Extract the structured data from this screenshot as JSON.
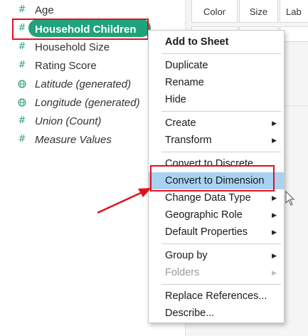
{
  "marks_card": {
    "buttons": [
      {
        "label": "Color"
      },
      {
        "label": "Size"
      },
      {
        "label": "Lab"
      }
    ]
  },
  "fields": [
    {
      "label": "Age",
      "type_icon": "#",
      "italic": false,
      "selected": false
    },
    {
      "label": "Household Children",
      "type_icon": "#",
      "italic": false,
      "selected": true
    },
    {
      "label": "Household Size",
      "type_icon": "#",
      "italic": false,
      "selected": false
    },
    {
      "label": "Rating Score",
      "type_icon": "#",
      "italic": false,
      "selected": false
    },
    {
      "label": "Latitude (generated)",
      "type_icon": "globe-icon",
      "italic": true,
      "selected": false
    },
    {
      "label": "Longitude (generated)",
      "type_icon": "globe-icon",
      "italic": true,
      "selected": false
    },
    {
      "label": "Union (Count)",
      "type_icon": "#",
      "italic": true,
      "selected": false
    },
    {
      "label": "Measure Values",
      "type_icon": "#",
      "italic": true,
      "selected": false
    }
  ],
  "context_menu": {
    "groups": [
      [
        {
          "label": "Add to Sheet",
          "bold": true,
          "submenu": false,
          "disabled": false,
          "highlighted": false
        }
      ],
      [
        {
          "label": "Duplicate",
          "submenu": false,
          "disabled": false,
          "highlighted": false
        },
        {
          "label": "Rename",
          "submenu": false,
          "disabled": false,
          "highlighted": false
        },
        {
          "label": "Hide",
          "submenu": false,
          "disabled": false,
          "highlighted": false
        }
      ],
      [
        {
          "label": "Create",
          "submenu": true,
          "disabled": false,
          "highlighted": false
        },
        {
          "label": "Transform",
          "submenu": true,
          "disabled": false,
          "highlighted": false
        }
      ],
      [
        {
          "label": "Convert to Discrete",
          "submenu": false,
          "disabled": false,
          "highlighted": false
        },
        {
          "label": "Convert to Dimension",
          "submenu": false,
          "disabled": false,
          "highlighted": true
        },
        {
          "label": "Change Data Type",
          "submenu": true,
          "disabled": false,
          "highlighted": false
        },
        {
          "label": "Geographic Role",
          "submenu": true,
          "disabled": false,
          "highlighted": false
        },
        {
          "label": "Default Properties",
          "submenu": true,
          "disabled": false,
          "highlighted": false
        }
      ],
      [
        {
          "label": "Group by",
          "submenu": true,
          "disabled": false,
          "highlighted": false
        },
        {
          "label": "Folders",
          "submenu": true,
          "disabled": true,
          "highlighted": false
        }
      ],
      [
        {
          "label": "Replace References...",
          "submenu": false,
          "disabled": false,
          "highlighted": false
        },
        {
          "label": "Describe...",
          "submenu": false,
          "disabled": false,
          "highlighted": false
        }
      ]
    ]
  },
  "colors": {
    "accent_green": "#1fa37c",
    "field_icon": "#3aa38a",
    "highlight_blue": "#a8d2f2",
    "annotation_red": "#e1111c"
  }
}
